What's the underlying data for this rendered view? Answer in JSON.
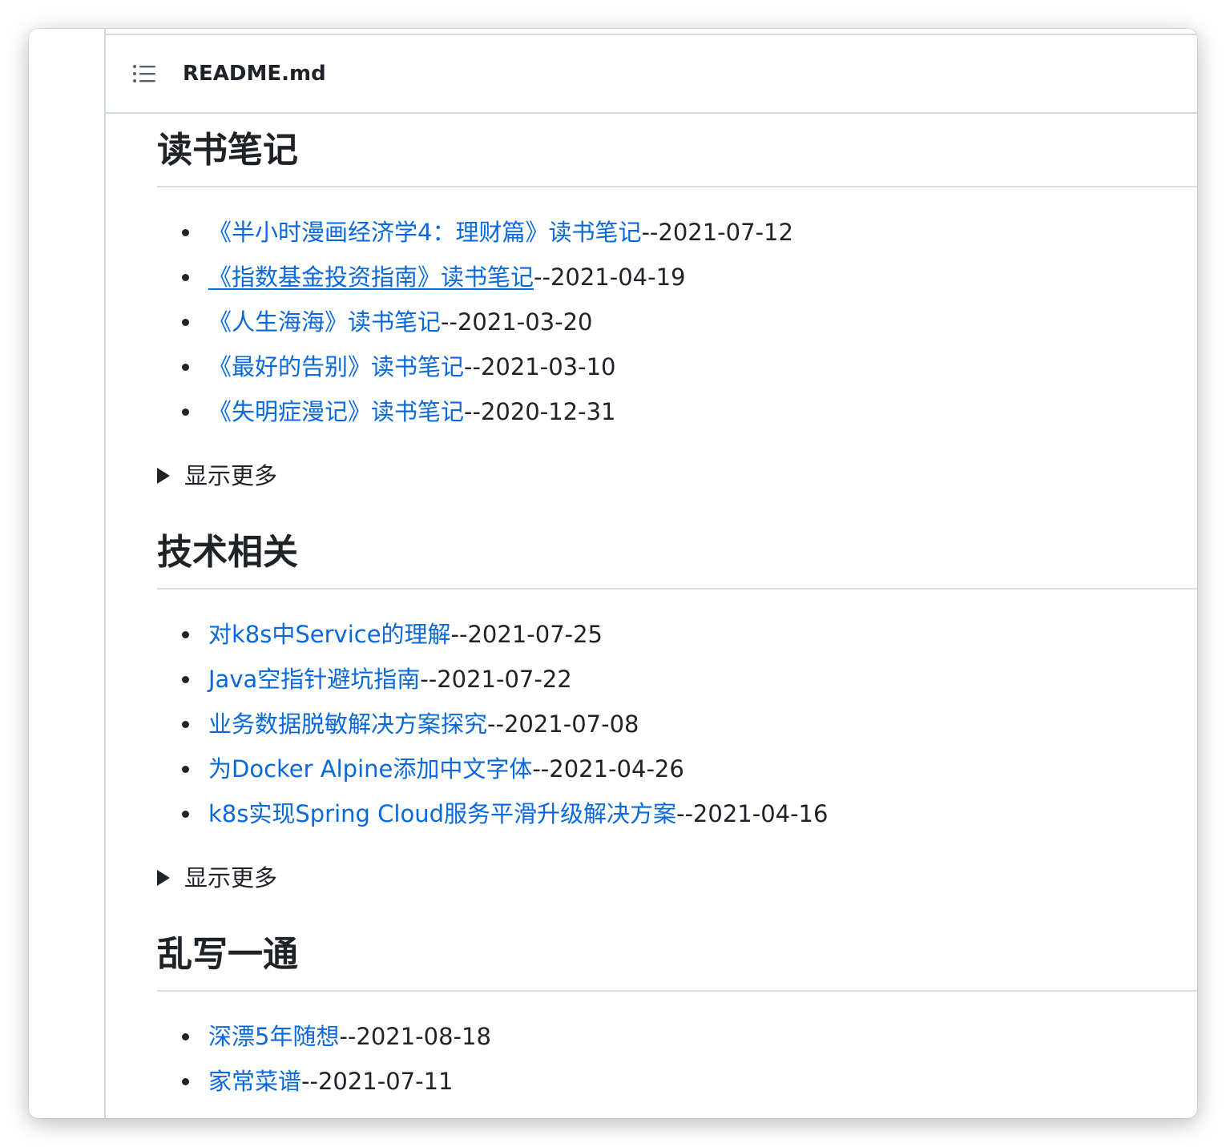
{
  "file_header": {
    "toc_icon": "list-icon",
    "file_name": "README.md"
  },
  "sections": [
    {
      "title": "读书笔记",
      "items": [
        {
          "link": "《半小时漫画经济学4：理财篇》读书笔记",
          "date": "--2021-07-12"
        },
        {
          "link": "《指数基金投资指南》读书笔记",
          "date": "--2021-04-19"
        },
        {
          "link": "《人生海海》读书笔记",
          "date": "--2021-03-20"
        },
        {
          "link": "《最好的告别》读书笔记",
          "date": "--2021-03-10"
        },
        {
          "link": "《失明症漫记》读书笔记",
          "date": "--2020-12-31"
        }
      ],
      "show_more": "显示更多"
    },
    {
      "title": "技术相关",
      "items": [
        {
          "link": "对k8s中Service的理解",
          "date": "--2021-07-25"
        },
        {
          "link": "Java空指针避坑指南",
          "date": "--2021-07-22"
        },
        {
          "link": "业务数据脱敏解决方案探究",
          "date": "--2021-07-08"
        },
        {
          "link": "为Docker Alpine添加中文字体",
          "date": "--2021-04-26"
        },
        {
          "link": "k8s实现Spring Cloud服务平滑升级解决方案",
          "date": "--2021-04-16"
        }
      ],
      "show_more": "显示更多"
    },
    {
      "title": "乱写一通",
      "items": [
        {
          "link": "深漂5年随想",
          "date": "--2021-08-18"
        },
        {
          "link": "家常菜谱",
          "date": "--2021-07-11"
        }
      ]
    }
  ],
  "colors": {
    "link": "#0969da",
    "text": "#1f2328",
    "border": "#d0d7de"
  }
}
